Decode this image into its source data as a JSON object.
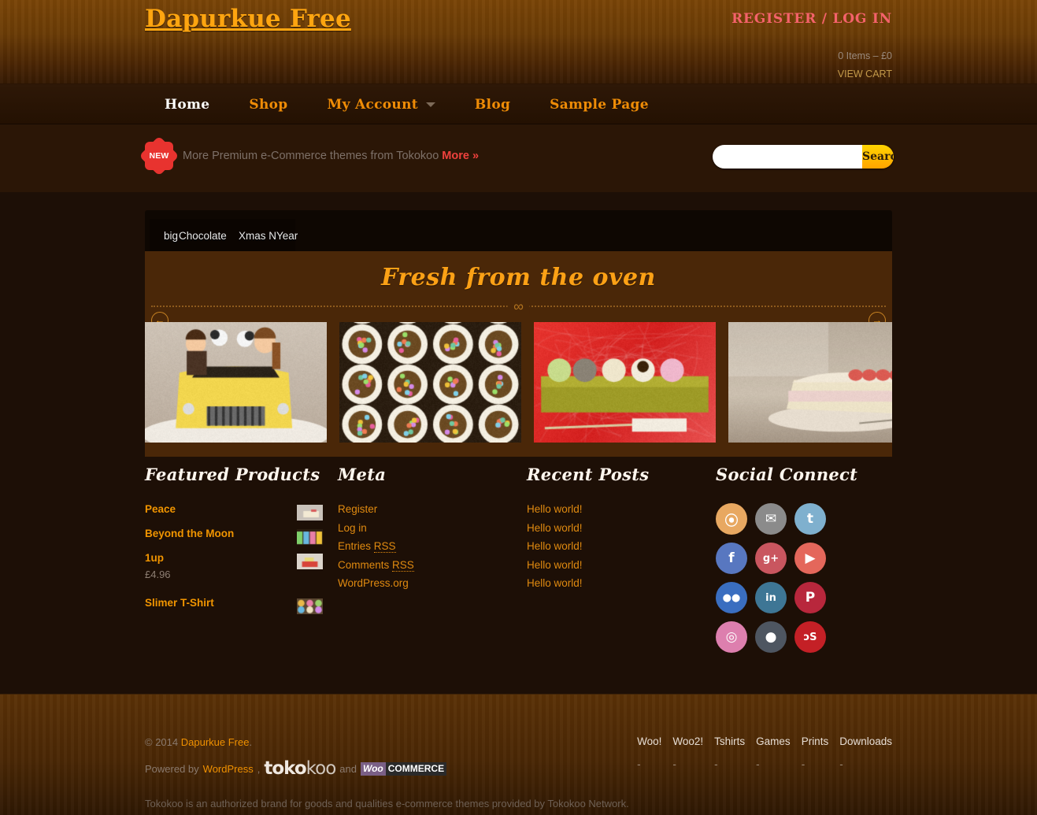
{
  "header": {
    "logo": "Dapurkue Free",
    "register_label": "REGISTER",
    "separator": "/",
    "login_label": "LOG IN",
    "cart_summary": "0 Items –  £0",
    "view_cart_label": "VIEW CART"
  },
  "nav": {
    "items": [
      {
        "label": "Home",
        "active": true
      },
      {
        "label": "Shop",
        "active": false
      },
      {
        "label": "My Account",
        "active": false,
        "has_dropdown": true
      },
      {
        "label": "Blog",
        "active": false
      },
      {
        "label": "Sample Page",
        "active": false
      }
    ]
  },
  "promo": {
    "badge": "NEW",
    "text": "More Premium e-Commerce themes from Tokokoo",
    "more_label": "More »"
  },
  "search": {
    "value": "",
    "placeholder": "",
    "button_label": "Search"
  },
  "slider": {
    "thumb_labels": [
      "big",
      "Chocolate",
      "Xmas NYear"
    ],
    "title": "Fresh from the oven",
    "prev_icon": "←",
    "next_icon": "→",
    "ornament": "∞"
  },
  "widgets": {
    "featured": {
      "title": "Featured Products",
      "products": [
        {
          "name": "Peace",
          "price": ""
        },
        {
          "name": "Beyond the Moon",
          "price": ""
        },
        {
          "name": "1up",
          "price": "£4.96"
        },
        {
          "name": "Slimer T-Shirt",
          "price": ""
        }
      ]
    },
    "meta": {
      "title": "Meta",
      "items": [
        {
          "text": "Register",
          "abbr": ""
        },
        {
          "text": "Log in",
          "abbr": ""
        },
        {
          "text": "Entries ",
          "abbr": "RSS"
        },
        {
          "text": "Comments ",
          "abbr": "RSS"
        },
        {
          "text": "WordPress.org",
          "abbr": ""
        }
      ]
    },
    "recent_posts": {
      "title": "Recent Posts",
      "items": [
        "Hello world!",
        "Hello world!",
        "Hello world!",
        "Hello world!",
        "Hello world!"
      ]
    },
    "social": {
      "title": "Social Connect",
      "icons": [
        {
          "name": "rss-icon",
          "glyph": "⦿",
          "color": "#e8a861"
        },
        {
          "name": "email-icon",
          "glyph": "✉",
          "color": "#8b8b8b"
        },
        {
          "name": "twitter-icon",
          "glyph": "t",
          "color": "#7fb0ce"
        },
        {
          "name": "facebook-icon",
          "glyph": "f",
          "color": "#5877c0"
        },
        {
          "name": "googleplus-icon",
          "glyph": "g+",
          "color": "#c9565f"
        },
        {
          "name": "youtube-icon",
          "glyph": "▶",
          "color": "#e4675b"
        },
        {
          "name": "flickr-icon",
          "glyph": "●●",
          "color": "#3a6ec0"
        },
        {
          "name": "linkedin-icon",
          "glyph": "in",
          "color": "#3e7695"
        },
        {
          "name": "pinterest-icon",
          "glyph": "P",
          "color": "#b8273c"
        },
        {
          "name": "dribbble-icon",
          "glyph": "◎",
          "color": "#dd7fae"
        },
        {
          "name": "github-icon",
          "glyph": "●",
          "color": "#4e5661"
        },
        {
          "name": "lastfm-icon",
          "glyph": "ɔS",
          "color": "#c42026"
        }
      ]
    }
  },
  "footer": {
    "copyright_prefix": "© 2014",
    "copyright_link": "Dapurkue Free",
    "copyright_suffix": ".",
    "powered_prefix": "Powered by",
    "wordpress_label": "WordPress",
    "powered_comma": ",",
    "tokokoo_a": "toko",
    "tokokoo_b": "koo",
    "and_label": "and",
    "woo_a": "Woo",
    "woo_b": "COMMERCE",
    "nav": [
      "Woo!",
      "Woo2!",
      "Tshirts",
      "Games",
      "Prints",
      "Downloads"
    ],
    "dash": "-",
    "note": "Tokokoo is an authorized brand for goods and qualities e-commerce themes provided by Tokokoo Network."
  },
  "colors": {
    "accent_orange": "#ef8c06",
    "logo_orange": "#ffa510",
    "register_pink": "#f4626b",
    "header_brown": "#6b3c06",
    "nav_dark": "#2a1304",
    "body_dark": "#1d0f06",
    "panel_brown": "#4a2708"
  }
}
